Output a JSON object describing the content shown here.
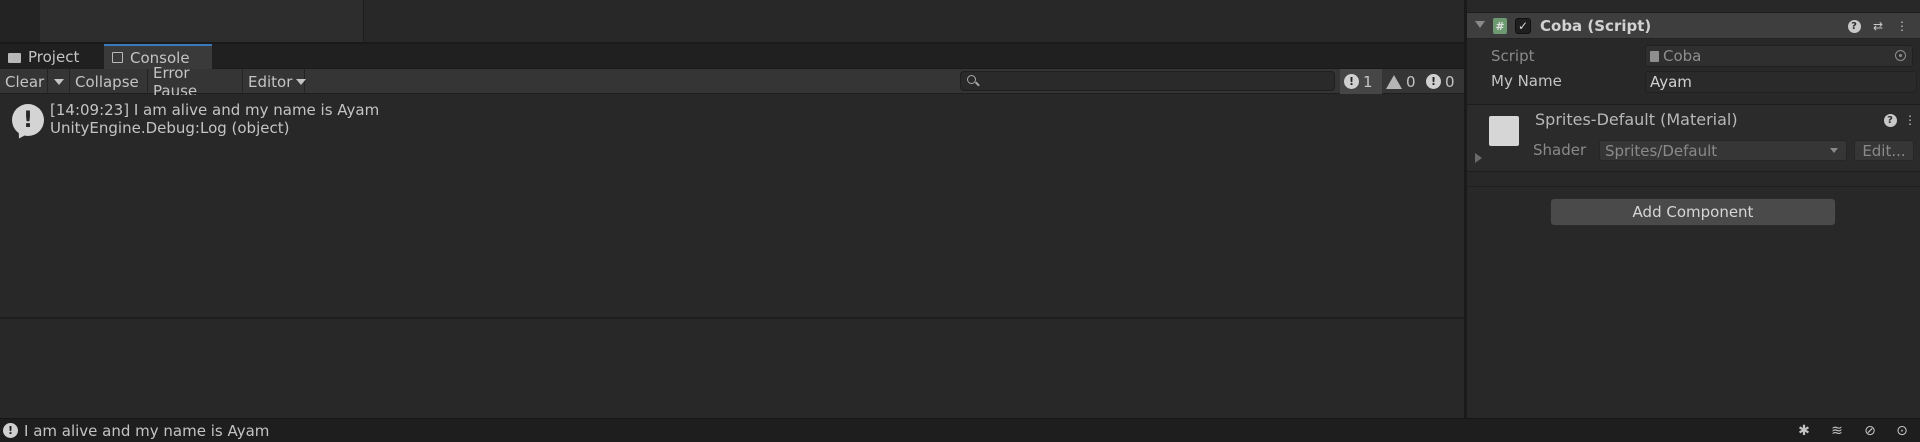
{
  "tabs": [
    {
      "label": "Project",
      "icon": "folder-icon"
    },
    {
      "label": "Console",
      "icon": "console-icon"
    }
  ],
  "toolbar": {
    "clear_label": "Clear",
    "collapse_label": "Collapse",
    "error_pause_label": "Error Pause",
    "editor_label": "Editor"
  },
  "search": {
    "value": "",
    "placeholder": ""
  },
  "counters": {
    "info": "1",
    "warning": "0",
    "error": "0"
  },
  "console": {
    "entries": [
      {
        "line1": "[14:09:23] I am alive and my name is Ayam",
        "line2": "UnityEngine.Debug:Log (object)"
      }
    ]
  },
  "inspector": {
    "component_title": "Coba (Script)",
    "enabled": true,
    "script_label": "Script",
    "script_value": "Coba",
    "my_name_label": "My Name",
    "my_name_value": "Ayam",
    "material_title": "Sprites-Default (Material)",
    "shader_label": "Shader",
    "shader_value": "Sprites/Default",
    "edit_label": "Edit...",
    "add_component_label": "Add Component"
  },
  "status_bar": {
    "message": "I am alive and my name is Ayam"
  },
  "colors": {
    "background": "#282828",
    "toolbar": "#353535",
    "tab_active": "#3a3a3a",
    "accent": "#3a79bb",
    "text": "#c4c4c4"
  }
}
